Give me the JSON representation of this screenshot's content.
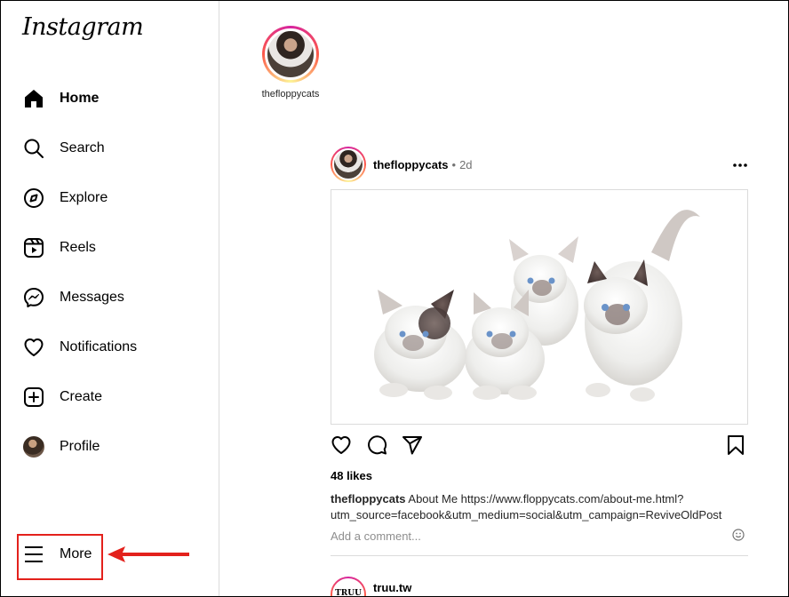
{
  "app": {
    "logo": "Instagram"
  },
  "nav": [
    {
      "label": "Home",
      "icon": "home-icon",
      "active": true
    },
    {
      "label": "Search",
      "icon": "search-icon"
    },
    {
      "label": "Explore",
      "icon": "compass-icon"
    },
    {
      "label": "Reels",
      "icon": "reels-icon"
    },
    {
      "label": "Messages",
      "icon": "messenger-icon"
    },
    {
      "label": "Notifications",
      "icon": "heart-icon"
    },
    {
      "label": "Create",
      "icon": "plus-square-icon"
    },
    {
      "label": "Profile",
      "icon": "avatar"
    }
  ],
  "more": {
    "label": "More",
    "icon": "hamburger-menu-icon",
    "highlight_color": "#e3211c"
  },
  "stories": [
    {
      "username": "thefloppycats"
    }
  ],
  "post": {
    "username": "thefloppycats",
    "separator": "•",
    "time": "2d",
    "more_glyph": "•••",
    "likes": "48 likes",
    "caption_user": "thefloppycats",
    "caption_text": " About Me https://www.floppycats.com/about-me.html?utm_source=facebook&utm_medium=social&utm_campaign=ReviveOldPost",
    "comment_placeholder": "Add a comment..."
  },
  "post2": {
    "username": "truu.tw",
    "avatar_text": "TRUU",
    "more_glyph": "•••"
  },
  "colors": {
    "ring_gradient": [
      "#d6249f",
      "#fd5949",
      "#fdf497"
    ],
    "border": "#dbdbdb",
    "muted": "#737373"
  }
}
